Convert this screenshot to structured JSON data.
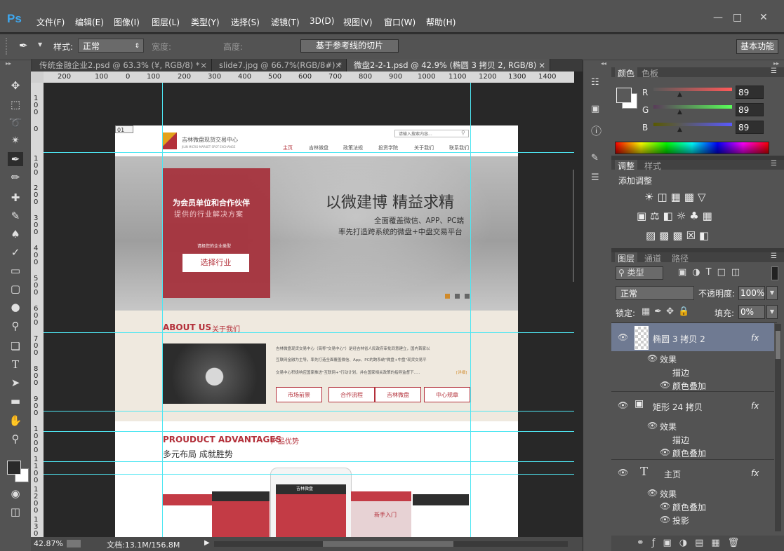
{
  "app": {
    "logo": "Ps",
    "menu": [
      "文件(F)",
      "编辑(E)",
      "图像(I)",
      "图层(L)",
      "类型(Y)",
      "选择(S)",
      "滤镜(T)",
      "3D(D)",
      "视图(V)",
      "窗口(W)",
      "帮助(H)"
    ],
    "window_controls": [
      "minimize",
      "maximize",
      "close"
    ]
  },
  "options": {
    "style_label": "样式:",
    "style_value": "正常",
    "width_label": "宽度:",
    "height_label": "高度:",
    "slice_button": "基于参考线的切片",
    "workspace_button": "基本功能"
  },
  "tabs": [
    {
      "label": "传统金融企业2.psd @ 63.3% (¥, RGB/8) *",
      "close": "×"
    },
    {
      "label": "slide7.jpg @ 66.7%(RGB/8#) *",
      "close": "×"
    },
    {
      "label": "微盘2-2-1.psd @ 42.9% (椭圆 3 拷贝 2, RGB/8)",
      "close": "×"
    }
  ],
  "ruler": {
    "h_ticks": [
      "200",
      "100",
      "0",
      "100",
      "200",
      "300",
      "400",
      "500",
      "600",
      "700",
      "800",
      "900",
      "1000",
      "1100",
      "1200",
      "1300",
      "1400"
    ],
    "v_ticks": [
      "100",
      "0",
      "100",
      "200",
      "300",
      "400",
      "500",
      "600",
      "700",
      "800",
      "900",
      "1000",
      "1100",
      "1200",
      "1300"
    ]
  },
  "document": {
    "slice_badge": "01",
    "site": {
      "logo_name": "吉林微盘现货交易中心",
      "logo_sub": "JILIN MICRO MARKET SPOT EXCHANGE",
      "search_placeholder": "请输入搜索内容...",
      "nav": [
        "主页",
        "吉林微盘",
        "政策法规",
        "投资学院",
        "关于我们",
        "联系我们"
      ],
      "hero_box_title": "为会员单位和合作伙伴",
      "hero_box_sub": "提供的行业解决方案",
      "hero_box_hint": "请择您的企业类型",
      "hero_button": "选择行业",
      "hero_title": "以微建博 精益求精",
      "hero_line1": "全面覆盖微信、APP、PC端",
      "hero_line2": "率先打造跨系统的微盘+中盘交易平台",
      "about_title_en": "ABOUT US",
      "about_title_cn": "关于我们",
      "about_p1": "吉林微盘现货交易中心（简称\"交易中心\"）是经吉林省人民政府审批同意建立，国内首家以",
      "about_p2": "互联网金融为主导，率先打造全面覆盖微信、App、PC的跨系统\"微盘+中盘\"现货交易平",
      "about_p3": "交易中心积极响应国家推进\"互联网+\"行动计划，并在国家相关政策的指导监督下.....",
      "about_more": "[详细]",
      "about_buttons": [
        "市场前景",
        "合作流程",
        "吉林微盘",
        "中心规章"
      ],
      "product_title_en": "PROUDUCT ADVANTAGES",
      "product_title_cn": "产品优势",
      "product_sub": "多元布局 成就胜势",
      "phone_header": "吉林微盘",
      "phone_banner": "新手入门"
    }
  },
  "status": {
    "zoom": "42.87%",
    "doc_label": "文档:13.1M/156.8M"
  },
  "color_panel": {
    "tabs": [
      "颜色",
      "色板"
    ],
    "channels": [
      {
        "name": "R",
        "value": "89"
      },
      {
        "name": "G",
        "value": "89"
      },
      {
        "name": "B",
        "value": "89"
      }
    ]
  },
  "adjust_panel": {
    "tabs": [
      "调整",
      "样式"
    ],
    "title": "添加调整"
  },
  "layers_panel": {
    "tabs": [
      "图层",
      "通道",
      "路径"
    ],
    "filter_kind": "类型",
    "blend_mode": "正常",
    "opacity_label": "不透明度:",
    "opacity_value": "100%",
    "lock_label": "锁定:",
    "fill_label": "填充:",
    "fill_value": "0%",
    "layers": [
      {
        "name": "椭圆 3 拷贝 2",
        "fx": "fx",
        "effects_label": "效果",
        "effects": [
          "描边",
          "颜色叠加"
        ]
      },
      {
        "name": "矩形 24 拷贝",
        "fx": "fx",
        "effects_label": "效果",
        "effects": [
          "描边",
          "颜色叠加"
        ]
      },
      {
        "name": "主页",
        "fx": "fx",
        "effects_label": "效果",
        "effects": [
          "颜色叠加",
          "投影"
        ]
      }
    ]
  },
  "colors": {
    "ui_bg": "#535353",
    "canvas_bg": "#282828",
    "guide": "#4ee6f2",
    "brand_red": "#b3303a",
    "ps_blue": "#3ea8f0"
  }
}
